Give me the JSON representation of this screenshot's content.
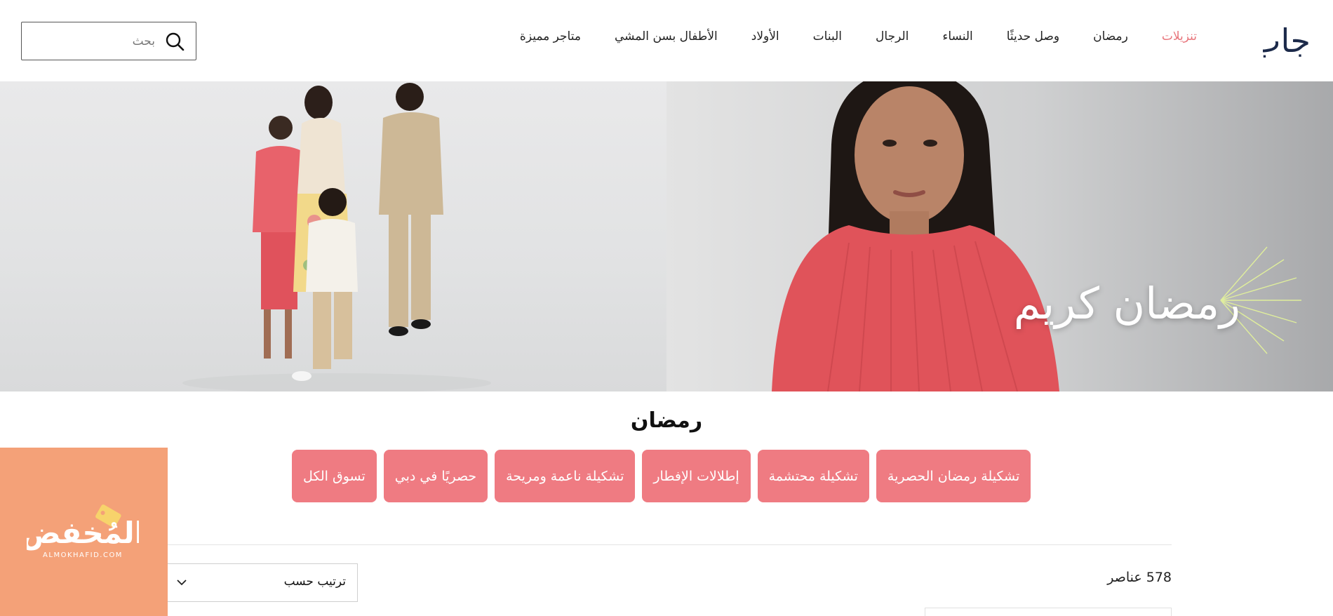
{
  "brand": {
    "logo_text": "جاب"
  },
  "nav": {
    "items": [
      {
        "label": "تنزيلات",
        "highlight": true
      },
      {
        "label": "رمضان"
      },
      {
        "label": "وصل حديثًا"
      },
      {
        "label": "النساء"
      },
      {
        "label": "الرجال"
      },
      {
        "label": "البنات"
      },
      {
        "label": "الأولاد"
      },
      {
        "label": "الأطفال بسن المشي"
      },
      {
        "label": "متاجر مميزة"
      }
    ]
  },
  "search": {
    "placeholder": "بحث",
    "icon": "search-icon"
  },
  "hero": {
    "headline": "رمضان كريم"
  },
  "section": {
    "title": "رمضان",
    "chips": [
      "تشكيلة رمضان الحصرية",
      "تشكيلة محتشمة",
      "إطلالات الإفطار",
      "تشكيلة ناعمة ومريحة",
      "حصريًا في دبي",
      "تسوق الكل"
    ]
  },
  "listing": {
    "count_label": "578 عناصر",
    "sort_label": "ترتيب حسب",
    "sort_icon": "chevron-down-icon"
  },
  "watermark": {
    "text": "المُخفض",
    "subtext": "ALMOKHAFID.COM"
  },
  "colors": {
    "sale": "#e8767c",
    "chip": "#ef7b82",
    "badge": "#f4a178",
    "accent_lime": "#d6f04a",
    "logo": "#1c2a4a"
  }
}
